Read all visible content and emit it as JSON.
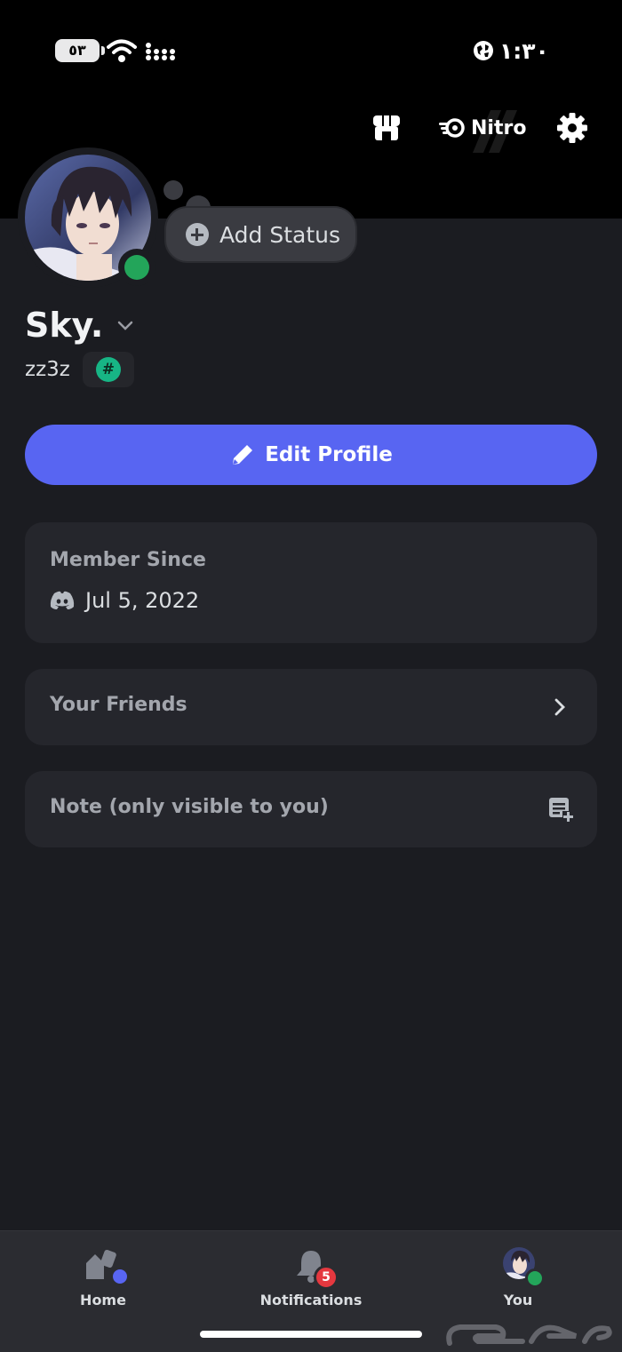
{
  "status_bar": {
    "battery": "٥٣",
    "time": "١:٣٠"
  },
  "top_actions": {
    "nitro_label": "Nitro"
  },
  "profile": {
    "status_button_label": "Add Status",
    "display_name": "Sky.",
    "username": "zz3z",
    "badge_symbol": "#",
    "edit_button_label": "Edit Profile"
  },
  "member_since": {
    "title": "Member Since",
    "date": "Jul 5, 2022"
  },
  "friends": {
    "label": "Your Friends"
  },
  "note": {
    "label": "Note (only visible to you)"
  },
  "tabbar": {
    "tabs": [
      {
        "label": "Home"
      },
      {
        "label": "Notifications",
        "badge": "5"
      },
      {
        "label": "You"
      }
    ]
  },
  "colors": {
    "accent": "#5865f2",
    "online": "#23a55a",
    "notification": "#e5383f",
    "background": "#1b1c21",
    "card": "#25262c"
  }
}
